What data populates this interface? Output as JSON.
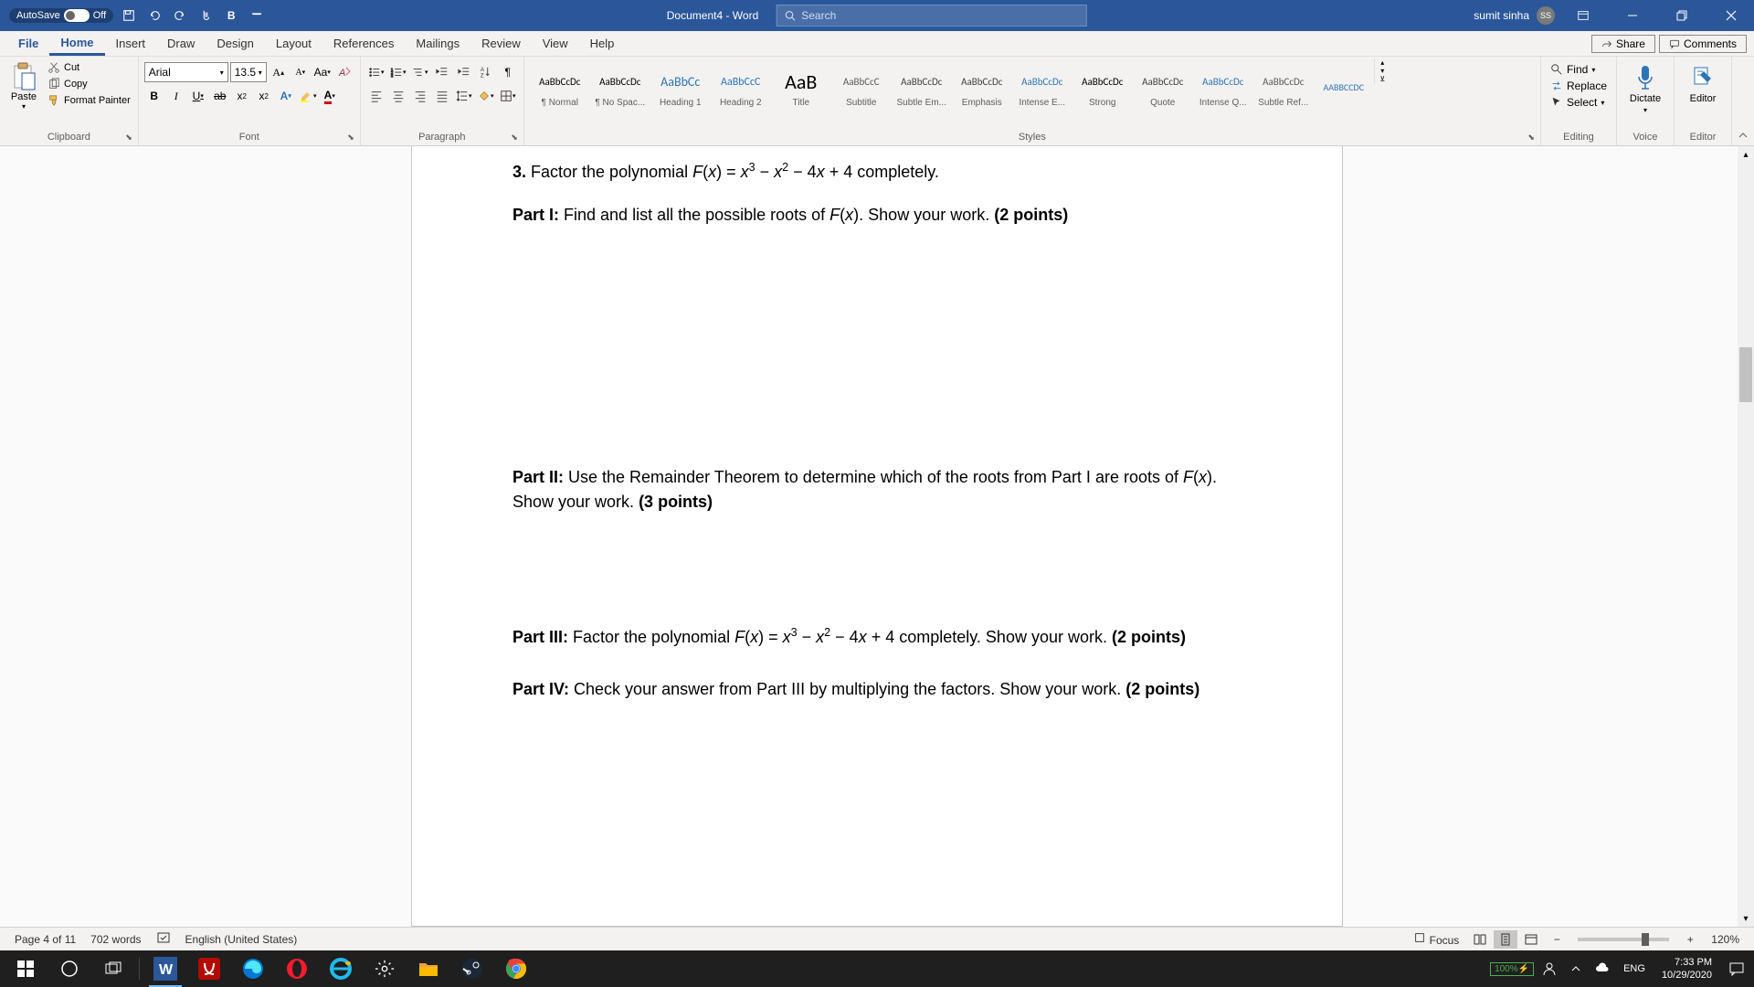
{
  "titlebar": {
    "autosave_label": "AutoSave",
    "autosave_state": "Off",
    "doc_title": "Document4 - Word",
    "search_placeholder": "Search",
    "user_name": "sumit sinha",
    "user_initials": "SS"
  },
  "tabs": {
    "file": "File",
    "home": "Home",
    "insert": "Insert",
    "draw": "Draw",
    "design": "Design",
    "layout": "Layout",
    "references": "References",
    "mailings": "Mailings",
    "review": "Review",
    "view": "View",
    "help": "Help",
    "share": "Share",
    "comments": "Comments"
  },
  "ribbon": {
    "clipboard": {
      "paste": "Paste",
      "cut": "Cut",
      "copy": "Copy",
      "format_painter": "Format Painter",
      "label": "Clipboard"
    },
    "font": {
      "name": "Arial",
      "size": "13.5",
      "label": "Font"
    },
    "paragraph": {
      "label": "Paragraph"
    },
    "styles": {
      "label": "Styles",
      "items": [
        {
          "preview": "AaBbCcDc",
          "name": "¶ Normal",
          "size": "11px",
          "color": "#000"
        },
        {
          "preview": "AaBbCcDc",
          "name": "¶ No Spac...",
          "size": "11px",
          "color": "#000"
        },
        {
          "preview": "AaBbCc",
          "name": "Heading 1",
          "size": "14px",
          "color": "#2e74b5"
        },
        {
          "preview": "AaBbCcC",
          "name": "Heading 2",
          "size": "12px",
          "color": "#2e74b5"
        },
        {
          "preview": "AaB",
          "name": "Title",
          "size": "22px",
          "color": "#000"
        },
        {
          "preview": "AaBbCcC",
          "name": "Subtitle",
          "size": "11px",
          "color": "#5a5a5a"
        },
        {
          "preview": "AaBbCcDc",
          "name": "Subtle Em...",
          "size": "11px",
          "color": "#404040"
        },
        {
          "preview": "AaBbCcDc",
          "name": "Emphasis",
          "size": "11px",
          "color": "#404040"
        },
        {
          "preview": "AaBbCcDc",
          "name": "Intense E...",
          "size": "11px",
          "color": "#2e74b5"
        },
        {
          "preview": "AaBbCcDc",
          "name": "Strong",
          "size": "11px",
          "color": "#000"
        },
        {
          "preview": "AaBbCcDc",
          "name": "Quote",
          "size": "11px",
          "color": "#404040"
        },
        {
          "preview": "AaBbCcDc",
          "name": "Intense Q...",
          "size": "11px",
          "color": "#2e74b5"
        },
        {
          "preview": "AaBbCcDc",
          "name": "Subtle Ref...",
          "size": "11px",
          "color": "#5a5a5a"
        },
        {
          "preview": "AABBCCDC",
          "name": "",
          "size": "10px",
          "color": "#2e74b5"
        }
      ]
    },
    "editing": {
      "find": "Find",
      "replace": "Replace",
      "select": "Select",
      "label": "Editing"
    },
    "voice": {
      "dictate": "Dictate",
      "label": "Voice"
    },
    "editor": {
      "editor": "Editor",
      "label": "Editor"
    }
  },
  "document": {
    "line1_prefix": "3. ",
    "line1_text": "Factor the polynomial F(x) = x³ − x² − 4x + 4 completely.",
    "part1_label": "Part I: ",
    "part1_text": "Find and list all the possible roots of F(x). Show your work. ",
    "part1_points": "(2 points)",
    "part2_label": "Part II: ",
    "part2_text": "Use the Remainder Theorem to determine which of the roots from Part I are roots of F(x). Show your work. ",
    "part2_points": "(3 points)",
    "part3_label": "Part III: ",
    "part3_text": "Factor the polynomial F(x) = x³ − x² − 4x + 4 completely. Show your work. ",
    "part3_points": "(2 points)",
    "part4_label": "Part IV: ",
    "part4_text": "Check your answer from Part III by multiplying the factors. Show your work. ",
    "part4_points": "(2 points)"
  },
  "statusbar": {
    "page": "Page 4 of 11",
    "words": "702 words",
    "language": "English (United States)",
    "focus": "Focus",
    "zoom": "120%"
  },
  "taskbar": {
    "battery": "100%",
    "lang": "ENG",
    "time": "7:33 PM",
    "date": "10/29/2020"
  }
}
